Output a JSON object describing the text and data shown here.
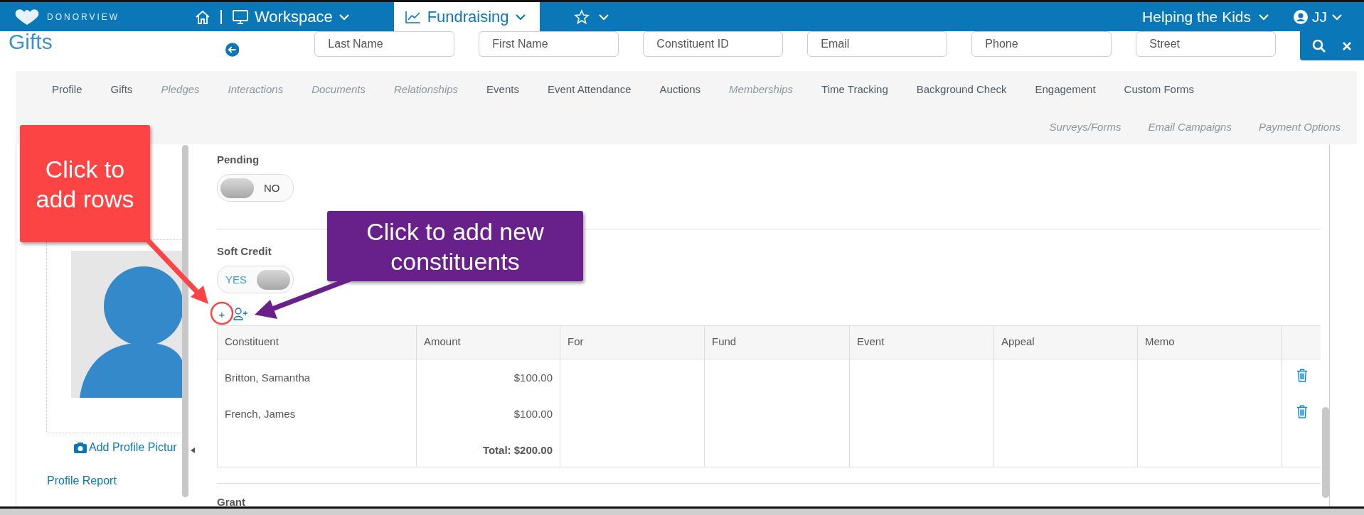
{
  "topbar": {
    "brand": "DONORVIEW",
    "nav": [
      {
        "label": "Workspace",
        "selected": false
      },
      {
        "label": "Fundraising",
        "selected": true
      }
    ],
    "organization": "Helping the Kids",
    "user": "JJ"
  },
  "page_title": "Gifts",
  "search_fields": [
    {
      "placeholder": "Last Name"
    },
    {
      "placeholder": "First Name"
    },
    {
      "placeholder": "Constituent ID"
    },
    {
      "placeholder": "Email"
    },
    {
      "placeholder": "Phone"
    },
    {
      "placeholder": "Street"
    }
  ],
  "tabs": [
    {
      "label": "Profile",
      "disabled": false
    },
    {
      "label": "Gifts",
      "disabled": false
    },
    {
      "label": "Pledges",
      "disabled": true
    },
    {
      "label": "Interactions",
      "disabled": true
    },
    {
      "label": "Documents",
      "disabled": true
    },
    {
      "label": "Relationships",
      "disabled": true
    },
    {
      "label": "Events",
      "disabled": false
    },
    {
      "label": "Event Attendance",
      "disabled": false
    },
    {
      "label": "Auctions",
      "disabled": false
    },
    {
      "label": "Memberships",
      "disabled": true
    },
    {
      "label": "Time Tracking",
      "disabled": false
    },
    {
      "label": "Background Check",
      "disabled": false
    },
    {
      "label": "Engagement",
      "disabled": false
    },
    {
      "label": "Custom Forms",
      "disabled": false
    }
  ],
  "tabs_row2": [
    {
      "label": "Surveys/Forms",
      "disabled": true
    },
    {
      "label": "Email Campaigns",
      "disabled": true
    },
    {
      "label": "Payment Options",
      "disabled": true
    }
  ],
  "profile": {
    "add_picture": "Add Profile Pictur",
    "report_link": "Profile Report"
  },
  "sections": [
    {
      "label": "Pending",
      "on": false,
      "toggle_text": "NO"
    },
    {
      "label": "Soft Credit",
      "on": true,
      "toggle_text": "YES"
    }
  ],
  "add_row_icon": "+",
  "table": {
    "columns": [
      "Constituent",
      "Amount",
      "For",
      "Fund",
      "Event",
      "Appeal",
      "Memo"
    ],
    "rows": [
      {
        "constituent": "Britton, Samantha",
        "amount": "$100.00"
      },
      {
        "constituent": "French, James",
        "amount": "$100.00"
      }
    ],
    "total": "Total: $200.00"
  },
  "next_section": "Grant",
  "callouts": [
    {
      "text": "Click to add rows",
      "color": "#fc4444"
    },
    {
      "text": "Click to add new constituents",
      "color": "#68218a"
    }
  ]
}
